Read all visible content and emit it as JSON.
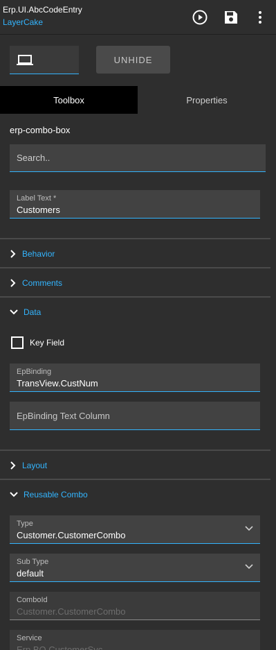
{
  "header": {
    "title": "Erp.UI.AbcCodeEntry",
    "subtitle": "LayerCake",
    "icons": [
      "play-circle-icon",
      "save-icon",
      "more-vert-icon"
    ]
  },
  "toolbar": {
    "device_icon": "laptop-icon",
    "unhide_label": "UNHIDE"
  },
  "tabs": [
    {
      "label": "Toolbox",
      "active": true
    },
    {
      "label": "Properties",
      "active": false
    }
  ],
  "component_name": "erp-combo-box",
  "search": {
    "placeholder": "Search.."
  },
  "label_text": {
    "label": "Label Text *",
    "value": "Customers"
  },
  "sections": {
    "behavior": "Behavior",
    "comments": "Comments",
    "data": "Data",
    "layout": "Layout",
    "reusable_combo": "Reusable Combo"
  },
  "data_section": {
    "key_field_label": "Key Field",
    "key_field_checked": false,
    "ep_binding": {
      "label": "EpBinding",
      "value": "TransView.CustNum"
    },
    "ep_binding_text_column": {
      "placeholder": "EpBinding Text Column"
    }
  },
  "reusable_combo": {
    "type": {
      "label": "Type",
      "value": "Customer.CustomerCombo"
    },
    "sub_type": {
      "label": "Sub Type",
      "value": "default"
    },
    "combo_id": {
      "label": "ComboId",
      "value": "Customer.CustomerCombo"
    },
    "service": {
      "label": "Service",
      "value": "Erp.BO.CustomerSvc"
    }
  },
  "colors": {
    "accent": "#33b5ff",
    "background": "#2e2e2e",
    "field_bg": "#424242",
    "active_tab": "#000000"
  }
}
